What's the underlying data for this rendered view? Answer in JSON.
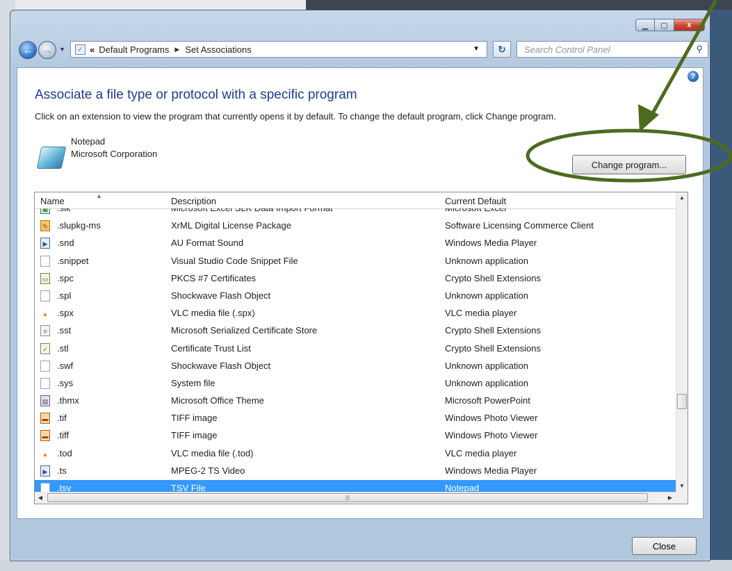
{
  "window": {
    "minimize_icon": "minimize-icon",
    "maximize_icon": "maximize-icon",
    "close_icon": "close-icon",
    "close_glyph": "x"
  },
  "nav": {
    "breadcrumb": [
      "Default Programs",
      "Set Associations"
    ],
    "chevron": "«",
    "search_placeholder": "Search Control Panel"
  },
  "header": {
    "title": "Associate a file type or protocol with a specific program",
    "description": "Click on an extension to view the program that currently opens it by default. To change the default program, click Change program."
  },
  "program": {
    "name": "Notepad",
    "company": "Microsoft Corporation",
    "change_label": "Change program..."
  },
  "table": {
    "columns": {
      "name": "Name",
      "description": "Description",
      "current_default": "Current Default"
    },
    "rows": [
      {
        "ext": ".slk",
        "desc": "Microsoft Excel SLK Data Import Format",
        "def": "Microsoft Excel",
        "icon": "excel-icon"
      },
      {
        "ext": ".slupkg-ms",
        "desc": "XrML Digital License Package",
        "def": "Software Licensing Commerce Client",
        "icon": "license-icon"
      },
      {
        "ext": ".snd",
        "desc": "AU Format Sound",
        "def": "Windows Media Player",
        "icon": "media-icon"
      },
      {
        "ext": ".snippet",
        "desc": "Visual Studio Code Snippet File",
        "def": "Unknown application",
        "icon": "blank-file-icon"
      },
      {
        "ext": ".spc",
        "desc": "PKCS #7 Certificates",
        "def": "Crypto Shell Extensions",
        "icon": "certificate-icon"
      },
      {
        "ext": ".spl",
        "desc": "Shockwave Flash Object",
        "def": "Unknown application",
        "icon": "blank-file-icon"
      },
      {
        "ext": ".spx",
        "desc": "VLC media file (.spx)",
        "def": "VLC media player",
        "icon": "vlc-icon"
      },
      {
        "ext": ".sst",
        "desc": "Microsoft Serialized Certificate Store",
        "def": "Crypto Shell Extensions",
        "icon": "cert-store-icon"
      },
      {
        "ext": ".stl",
        "desc": "Certificate Trust List",
        "def": "Crypto Shell Extensions",
        "icon": "trust-list-icon"
      },
      {
        "ext": ".swf",
        "desc": "Shockwave Flash Object",
        "def": "Unknown application",
        "icon": "blank-file-icon"
      },
      {
        "ext": ".sys",
        "desc": "System file",
        "def": "Unknown application",
        "icon": "blank-file-icon"
      },
      {
        "ext": ".thmx",
        "desc": "Microsoft Office Theme",
        "def": "Microsoft PowerPoint",
        "icon": "office-theme-icon"
      },
      {
        "ext": ".tif",
        "desc": "TIFF image",
        "def": "Windows Photo Viewer",
        "icon": "image-icon"
      },
      {
        "ext": ".tiff",
        "desc": "TIFF image",
        "def": "Windows Photo Viewer",
        "icon": "image-icon"
      },
      {
        "ext": ".tod",
        "desc": "VLC media file (.tod)",
        "def": "VLC media player",
        "icon": "vlc-icon"
      },
      {
        "ext": ".ts",
        "desc": "MPEG-2 TS Video",
        "def": "Windows Media Player",
        "icon": "media-icon"
      },
      {
        "ext": ".tsv",
        "desc": "TSV File",
        "def": "Notepad",
        "icon": "blank-file-icon",
        "selected": true
      }
    ]
  },
  "footer": {
    "close_label": "Close"
  },
  "annotation": {
    "color": "#4d6b1f",
    "shapes": [
      "arrow",
      "ellipse"
    ]
  },
  "colors": {
    "selection": "#3399ff",
    "title_text": "#1e3e8c"
  }
}
